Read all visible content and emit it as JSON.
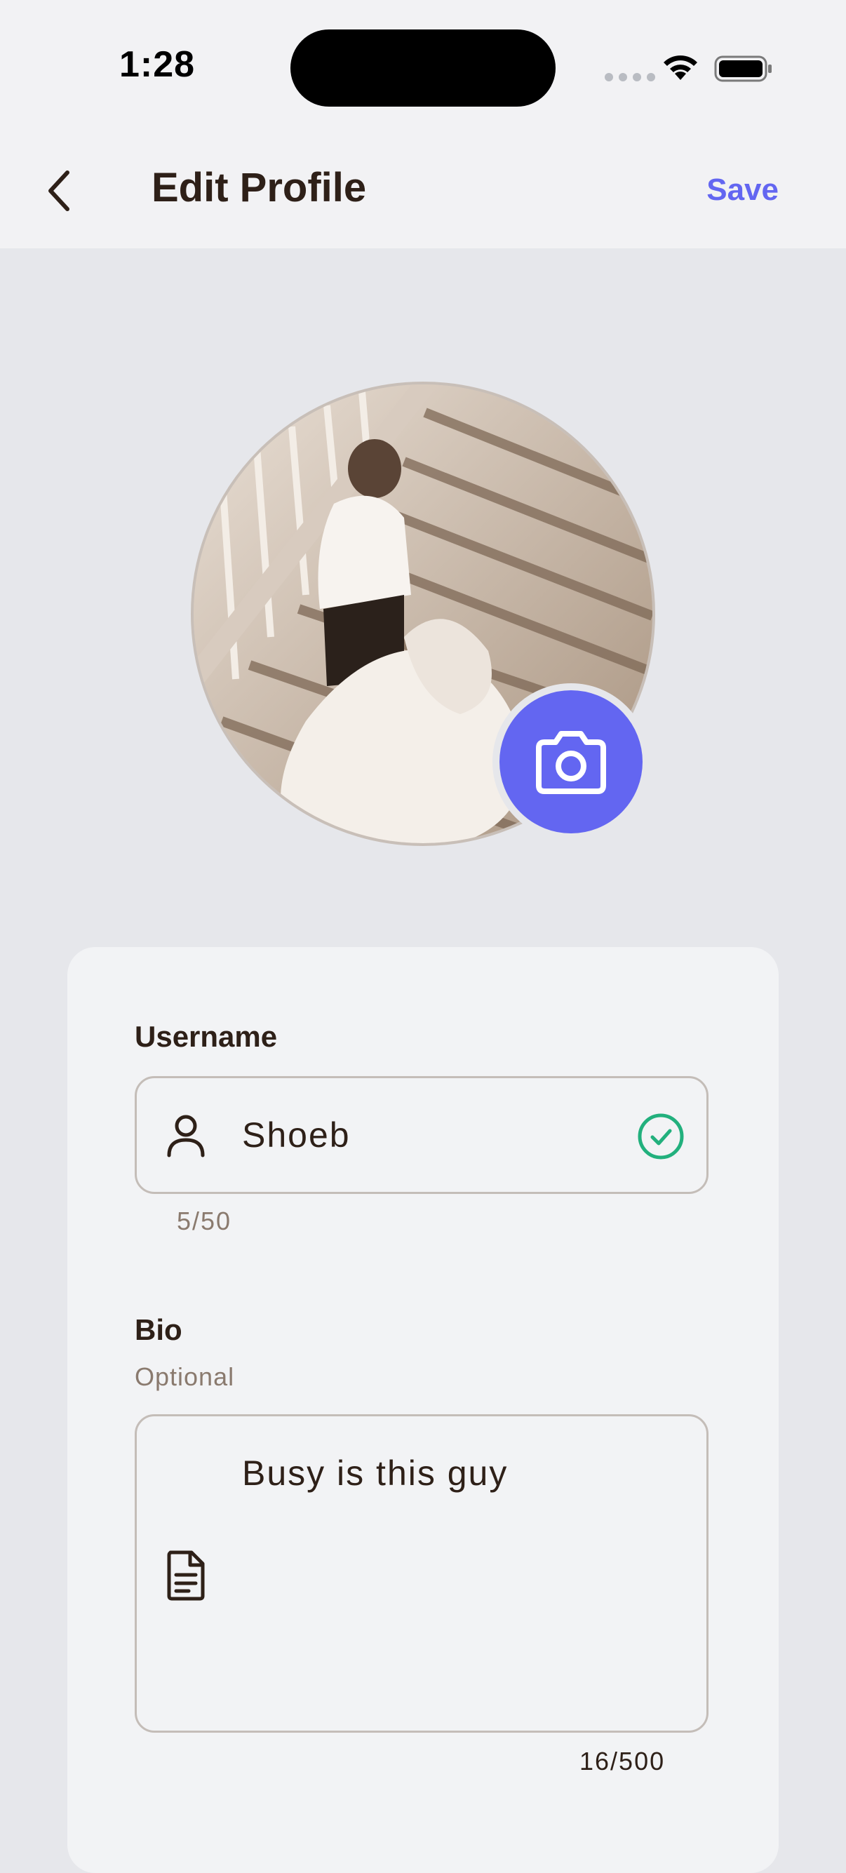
{
  "status_bar": {
    "time": "1:28"
  },
  "header": {
    "title": "Edit Profile",
    "save_label": "Save",
    "back_icon": "chevron-left-icon"
  },
  "avatar": {
    "camera_icon": "camera-icon"
  },
  "form": {
    "username": {
      "label": "Username",
      "value": "Shoeb",
      "counter": "5/50",
      "icon": "user-icon",
      "status_icon": "check-circle-icon"
    },
    "bio": {
      "label": "Bio",
      "optional": "Optional",
      "value": "Busy is this guy",
      "counter": "16/500",
      "icon": "document-icon"
    }
  },
  "colors": {
    "accent": "#6366f1",
    "valid": "#22b07d",
    "text": "#2e2018",
    "muted": "#8a7a6e"
  }
}
